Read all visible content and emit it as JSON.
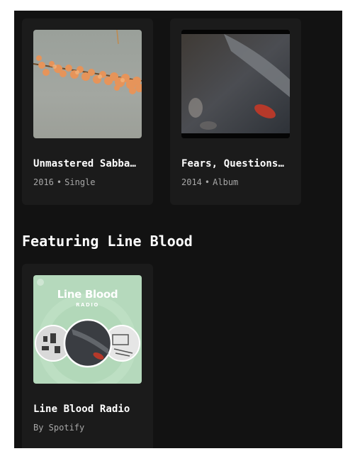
{
  "albums": [
    {
      "title": "Unmastered Sabbath",
      "year": "2016",
      "separator": "•",
      "type": "Single"
    },
    {
      "title": "Fears, Questions …",
      "year": "2014",
      "separator": "•",
      "type": "Album"
    }
  ],
  "featuring": {
    "heading": "Featuring Line Blood",
    "items": [
      {
        "title": "Line Blood Radio",
        "subtitle": "By Spotify",
        "cover_name": "Line Blood",
        "cover_tag": "RADIO"
      }
    ]
  },
  "colors": {
    "background": "#121212",
    "card": "#1b1b1b",
    "subtext": "#a7a7a7",
    "radio_cover": "#b5d9bc"
  }
}
